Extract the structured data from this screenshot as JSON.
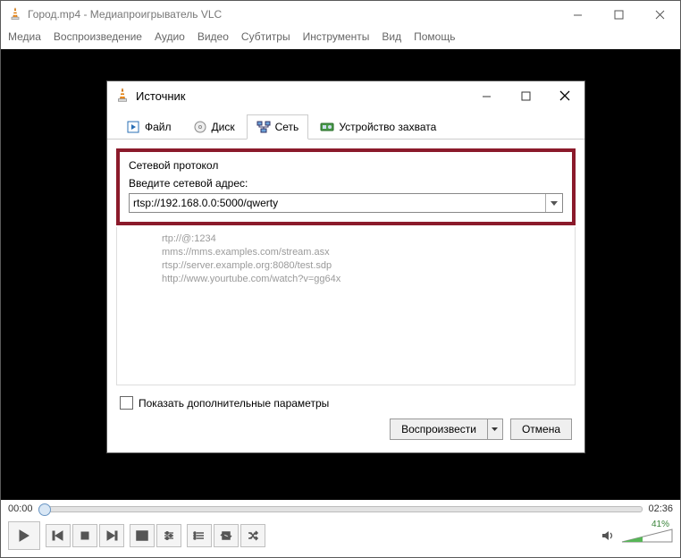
{
  "window": {
    "title": "Город.mp4 - Медиапроигрыватель VLC",
    "menus": [
      "Медиа",
      "Воспроизведение",
      "Аудио",
      "Видео",
      "Субтитры",
      "Инструменты",
      "Вид",
      "Помощь"
    ]
  },
  "dialog": {
    "title": "Источник",
    "tabs": {
      "file": "Файл",
      "disc": "Диск",
      "net": "Сеть",
      "capture": "Устройство захвата"
    },
    "net": {
      "group": "Сетевой протокол",
      "prompt": "Введите сетевой адрес:",
      "value": "rtsp://192.168.0.0:5000/qwerty",
      "examples": [
        "rtp://@:1234",
        "mms://mms.examples.com/stream.asx",
        "rtsp://server.example.org:8080/test.sdp",
        "http://www.yourtube.com/watch?v=gg64x"
      ]
    },
    "showMore": "Показать дополнительные параметры",
    "play": "Воспроизвести",
    "cancel": "Отмена"
  },
  "player": {
    "pos": "00:00",
    "dur": "02:36",
    "volumePct": "41%"
  }
}
